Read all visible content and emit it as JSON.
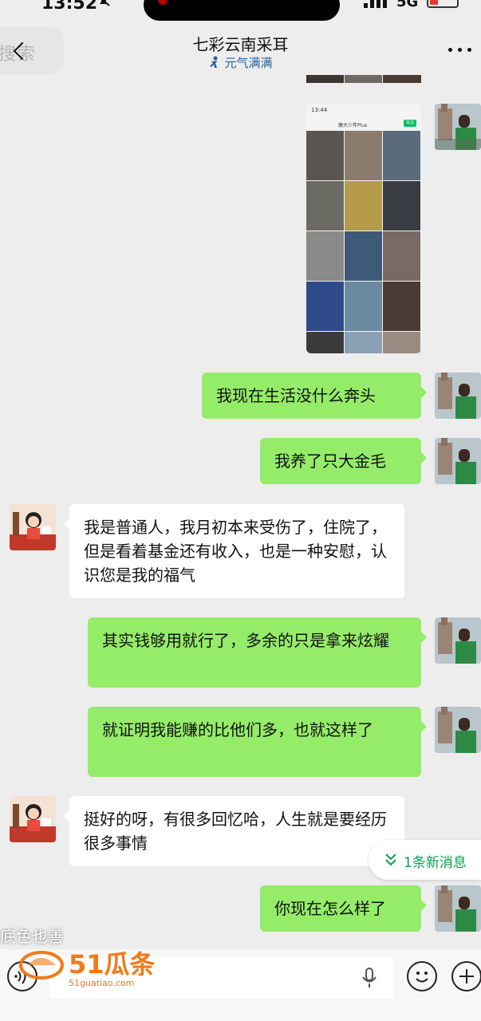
{
  "status_bar": {
    "time": "13:52",
    "network": "5G"
  },
  "header": {
    "back_search_text": "搜索",
    "title": "七彩云南采耳",
    "subtitle": "元气满满"
  },
  "screenshot_preview": {
    "time": "13:44",
    "name": "魔大少年Plus",
    "button": "关注"
  },
  "messages": [
    {
      "sender": "me",
      "text": "我现在生活没什么奔头"
    },
    {
      "sender": "me",
      "text": "我养了只大金毛"
    },
    {
      "sender": "other",
      "text": "我是普通人，我月初本来受伤了，住院了，但是看着基金还有收入，也是一种安慰，认识您是我的福气"
    },
    {
      "sender": "me",
      "text": "其实钱够用就行了，多余的只是拿来炫耀"
    },
    {
      "sender": "me",
      "text": "就证明我能赚的比他们多，也就这样了"
    },
    {
      "sender": "other",
      "text": "挺好的呀，有很多回忆哈，人生就是要经历很多事情"
    },
    {
      "sender": "me",
      "text": "你现在怎么样了"
    }
  ],
  "new_message_pill": "1条新消息",
  "watermark": {
    "text": "底色也善",
    "logo": "51瓜条",
    "domain": "51guatiao.com"
  },
  "colors": {
    "bubble_mine": "#95ec69",
    "bubble_other": "#ffffff",
    "background": "#ededed",
    "accent_green": "#07a04f"
  }
}
